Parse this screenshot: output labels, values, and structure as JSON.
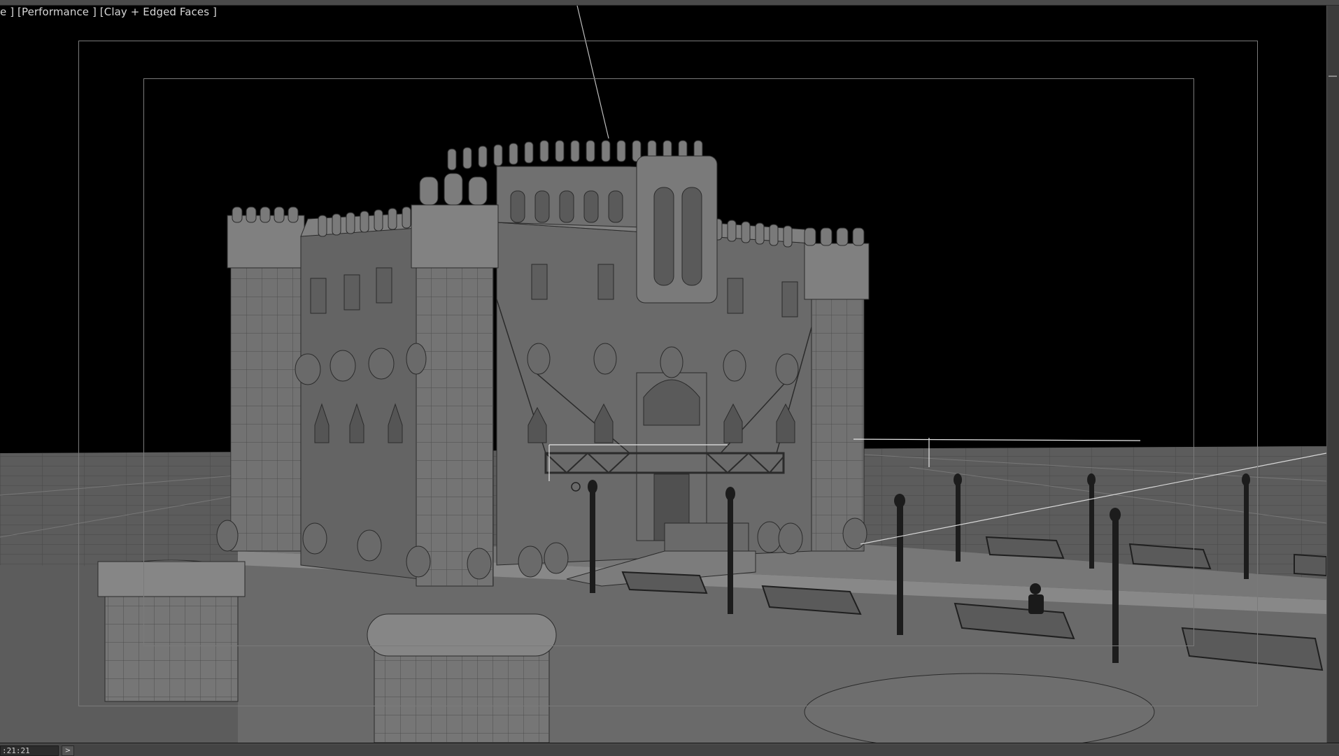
{
  "viewport": {
    "label": "e ] [Performance ] [Clay + Edged Faces ]"
  },
  "status": {
    "time": ":21:21",
    "next_icon": ">"
  },
  "colors": {
    "background": "#000000",
    "clay": "#6e6e6e",
    "edge": "#2b2b2b",
    "ground": "#595959",
    "frame": "#7a7a7a"
  }
}
